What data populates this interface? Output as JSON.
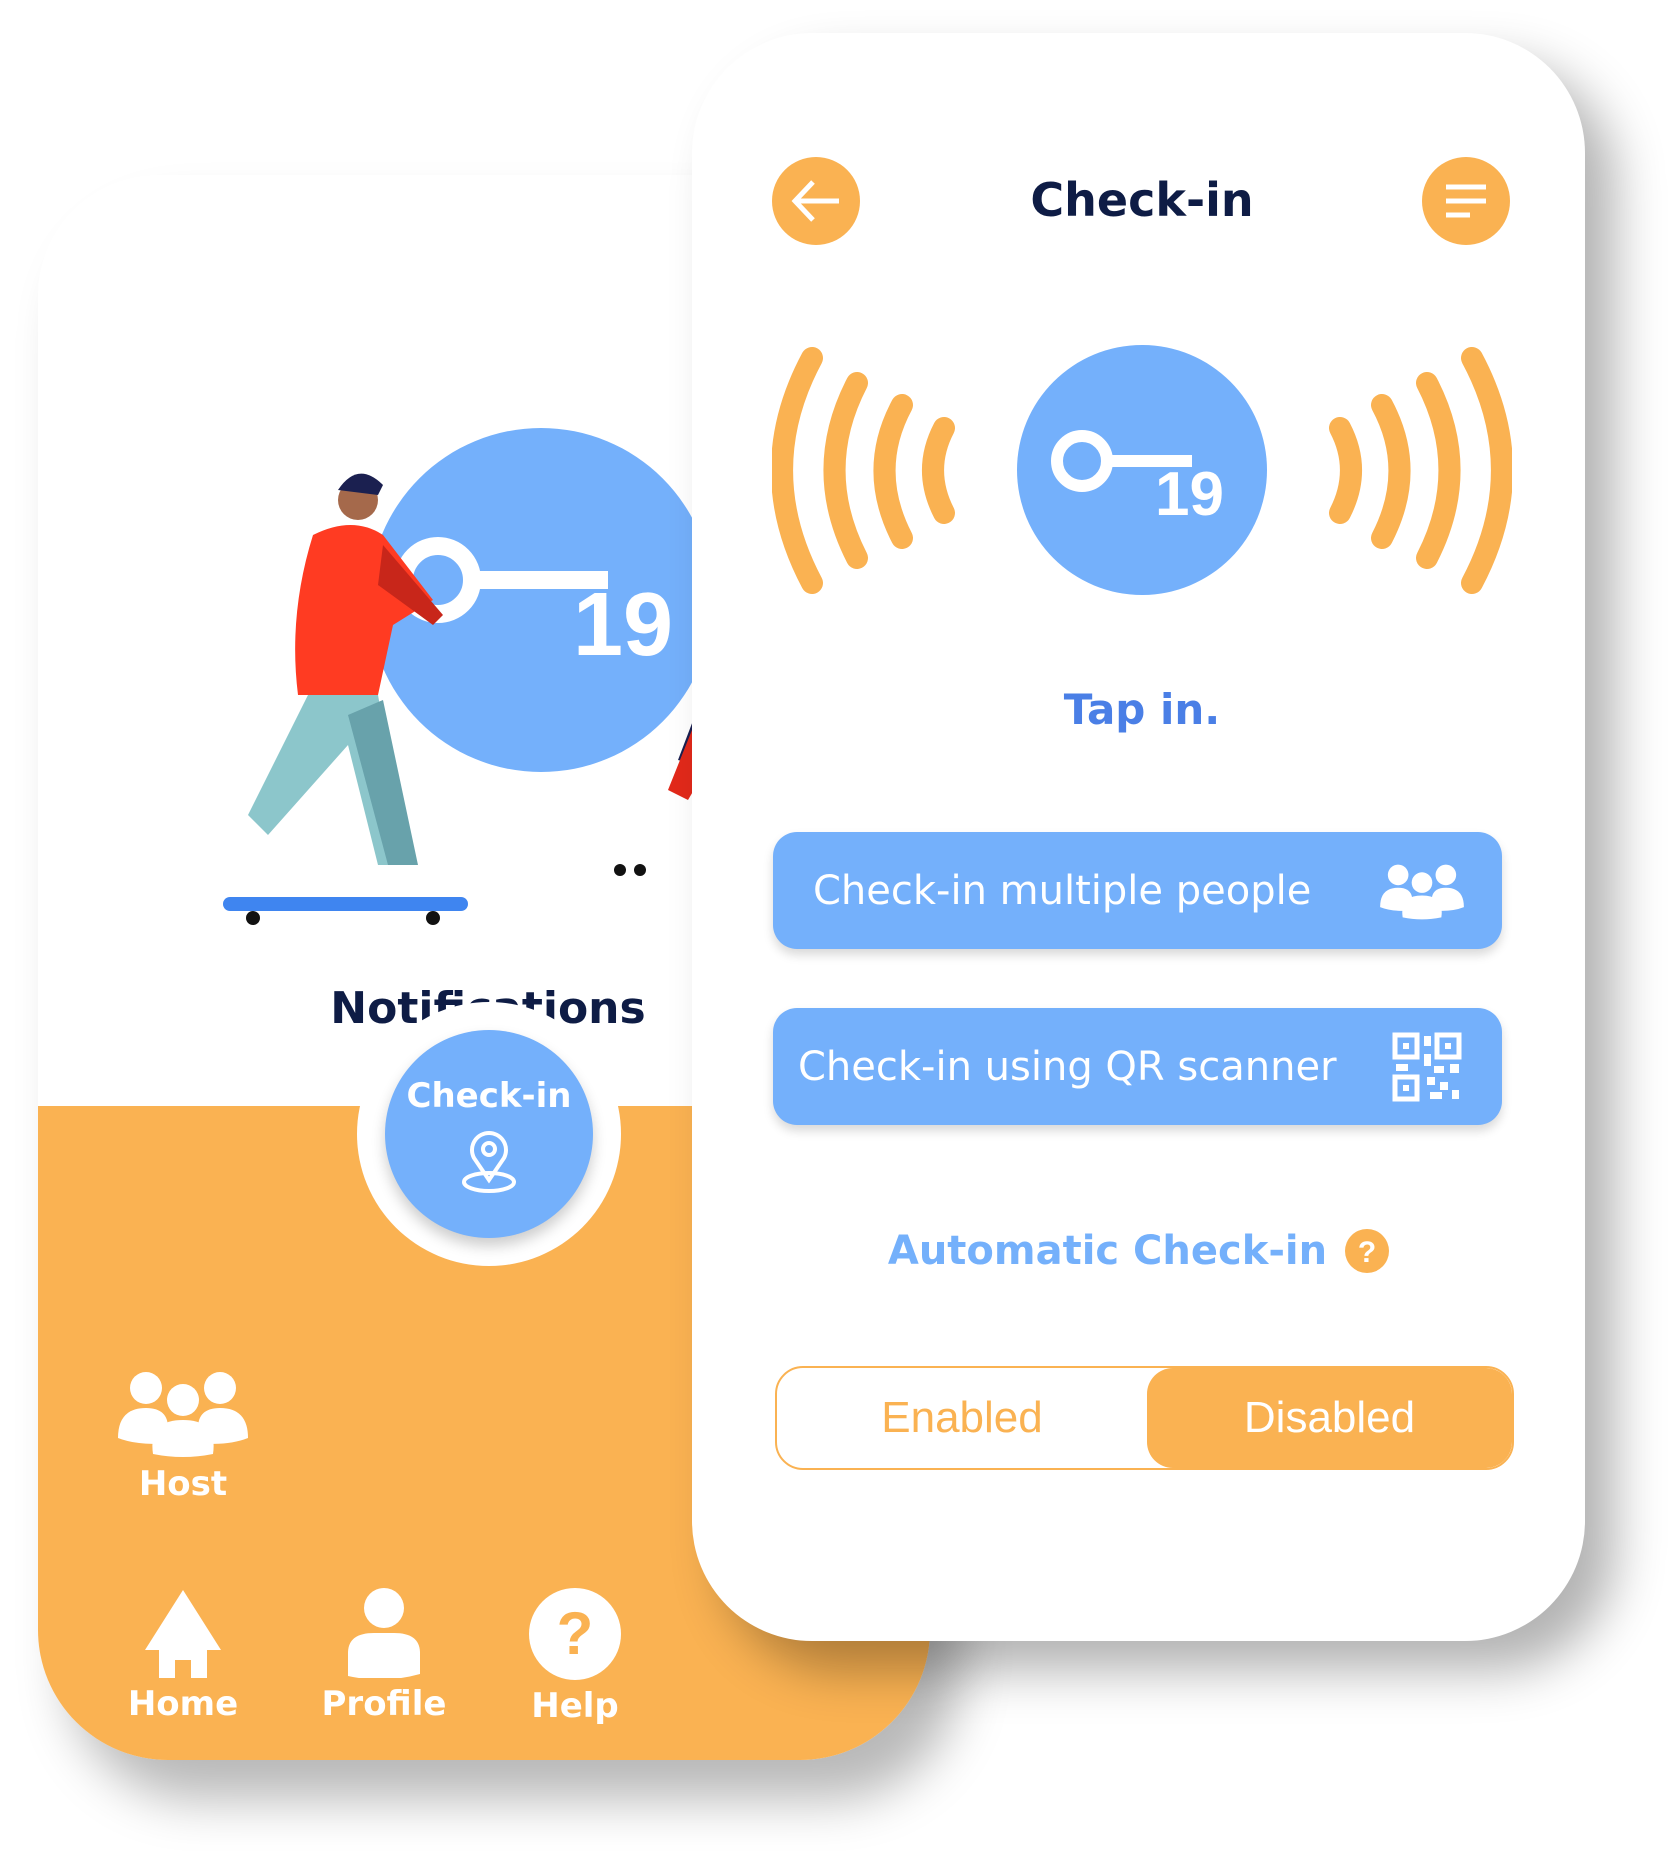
{
  "left_screen": {
    "title": "Notifications",
    "nav": {
      "checkin_label": "Check-in",
      "items": [
        {
          "label": "Host",
          "icon": "group-icon"
        },
        {
          "label": "Home",
          "icon": "home-icon"
        },
        {
          "label": "Profile",
          "icon": "person-icon"
        },
        {
          "label": "Help",
          "icon": "help-icon"
        }
      ],
      "close_icon": "close-icon"
    },
    "logo_text": "19"
  },
  "right_screen": {
    "title": "Check-in",
    "back_icon": "arrow-left-icon",
    "menu_icon": "menu-icon",
    "logo_text": "19",
    "tap_label": "Tap in.",
    "buttons": [
      {
        "label": "Check-in multiple people",
        "icon": "group-icon"
      },
      {
        "label": "Check-in using QR scanner",
        "icon": "qr-code-icon"
      }
    ],
    "auto_checkin_label": "Automatic Check-in",
    "toggle": {
      "options": [
        "Enabled",
        "Disabled"
      ],
      "selected": "Disabled"
    }
  },
  "colors": {
    "orange": "#fab252",
    "blue": "#74b0fb",
    "navy": "#0e1c45",
    "link_blue": "#4a7fe6"
  }
}
